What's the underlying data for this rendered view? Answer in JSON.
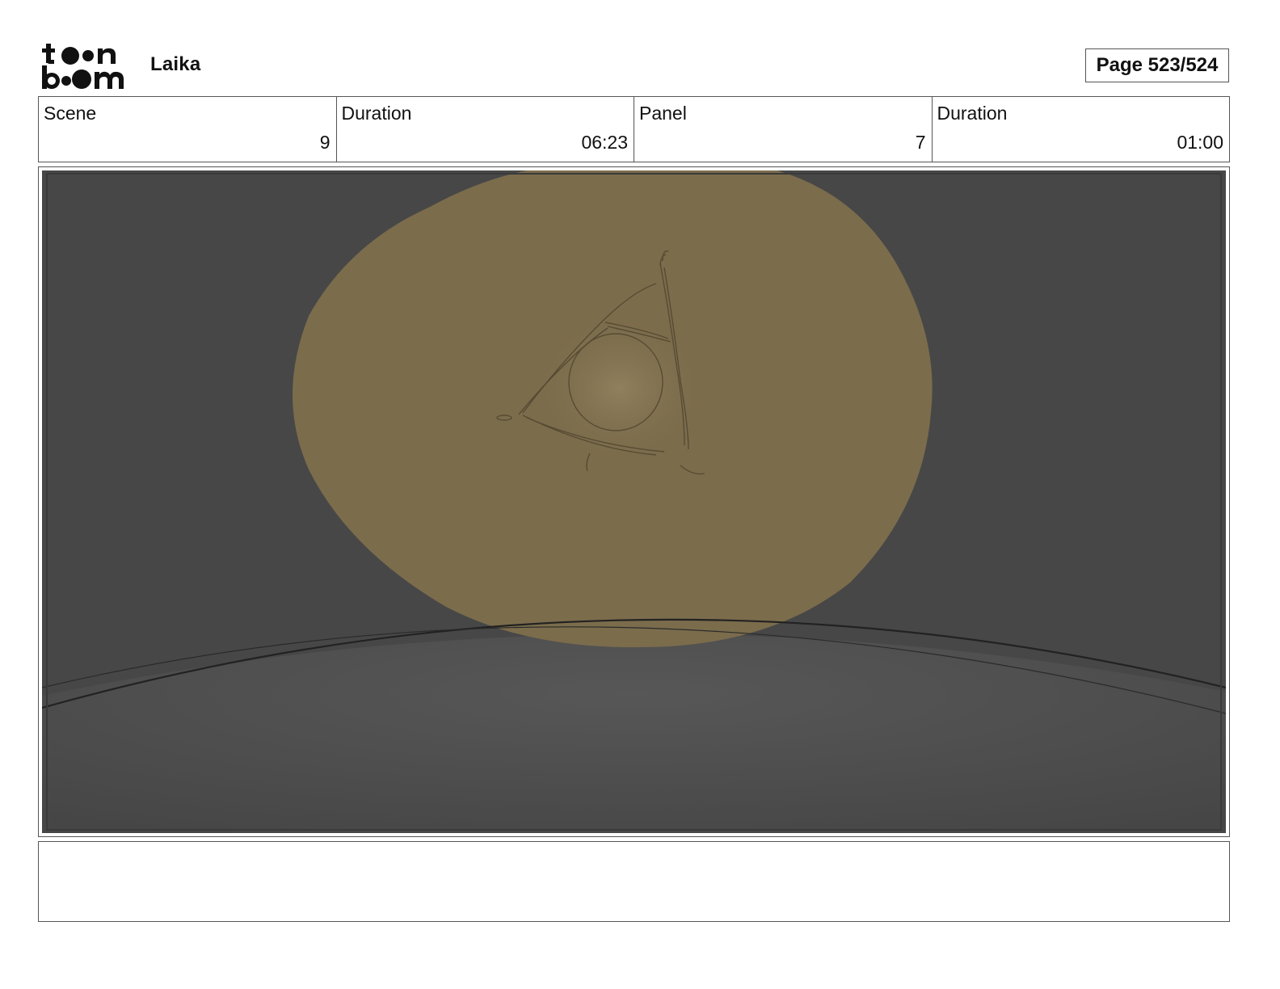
{
  "header": {
    "logo_text_top": "toon",
    "logo_text_bottom": "boom",
    "project_name": "Laika",
    "page_label": "Page 523/524"
  },
  "info": {
    "scene_label": "Scene",
    "scene_value": "9",
    "scene_duration_label": "Duration",
    "scene_duration_value": "06:23",
    "panel_label": "Panel",
    "panel_value": "7",
    "panel_duration_label": "Duration",
    "panel_duration_value": "01:00"
  },
  "panel_art": {
    "description_icon": "storyboard-panel-image",
    "colors": {
      "background": "#474747",
      "ground": "#4f4f4f",
      "glow": "#7b6c4c",
      "sketch_line": "#5a4e36",
      "horizon_line": "#1e1e1e"
    }
  },
  "notes": {
    "text": ""
  }
}
